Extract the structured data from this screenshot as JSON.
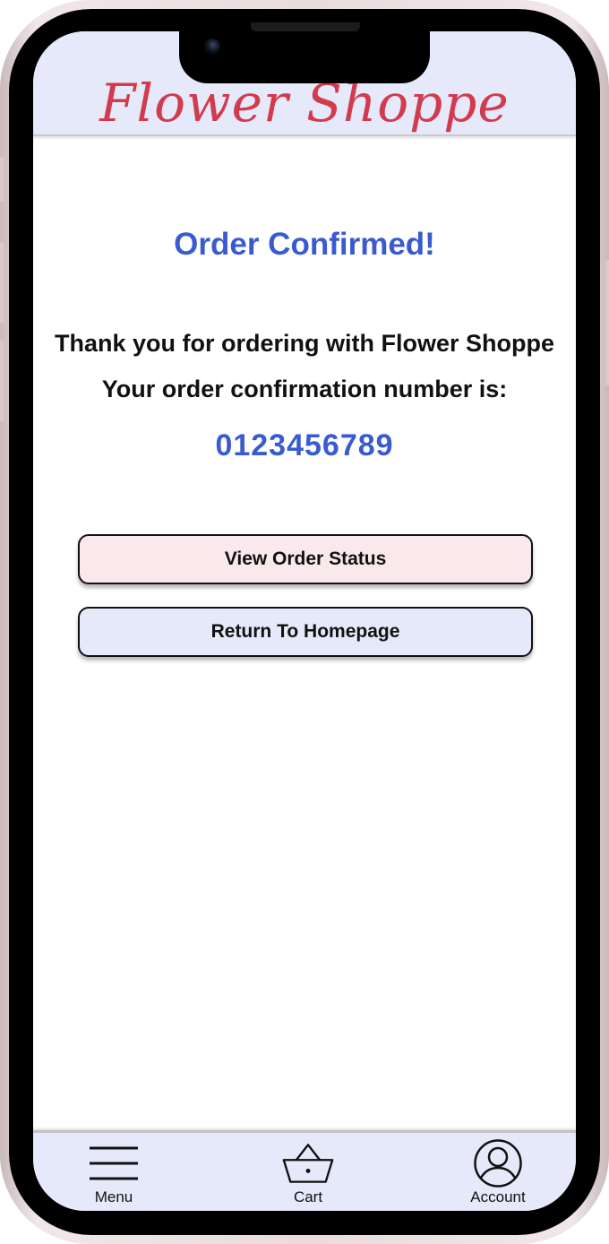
{
  "header": {
    "brand": "Flower Shoppe"
  },
  "main": {
    "title": "Order Confirmed!",
    "thanks_text": "Thank you for ordering with Flower Shoppe",
    "confirmation_label": "Your order confirmation number is:",
    "confirmation_number": "0123456789",
    "buttons": {
      "view_status": "View Order Status",
      "return_home": "Return To Homepage"
    }
  },
  "bottom_nav": {
    "items": [
      {
        "label": "Menu",
        "icon": "hamburger-menu-icon"
      },
      {
        "label": "Cart",
        "icon": "basket-icon"
      },
      {
        "label": "Account",
        "icon": "user-circle-icon"
      }
    ]
  },
  "colors": {
    "brand": "#d23a4e",
    "accent": "#3a5bd0",
    "header_bg": "#e6e9fa",
    "status_button_bg": "#f9e9ec",
    "home_button_bg": "#e6e9fa"
  }
}
